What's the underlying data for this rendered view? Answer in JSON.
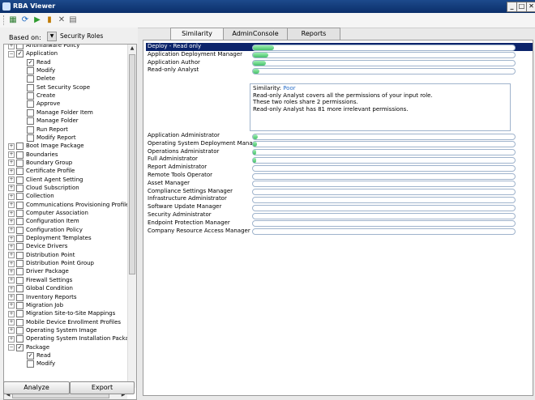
{
  "window": {
    "title": "RBA Viewer"
  },
  "toolbar": {
    "icons": [
      "grid-icon",
      "refresh-icon",
      "play-icon",
      "save-icon",
      "close-icon",
      "export-icon"
    ]
  },
  "left_panel": {
    "based_on_label": "Based on:",
    "based_on_value": "Security Roles",
    "tree": [
      {
        "label": "Antimalware Policy",
        "level": 0,
        "expander": "+",
        "checked": false
      },
      {
        "label": "Application",
        "level": 0,
        "expander": "−",
        "checked": true
      },
      {
        "label": "Read",
        "level": 1,
        "checked": true
      },
      {
        "label": "Modify",
        "level": 1,
        "checked": false
      },
      {
        "label": "Delete",
        "level": 1,
        "checked": false
      },
      {
        "label": "Set Security Scope",
        "level": 1,
        "checked": false
      },
      {
        "label": "Create",
        "level": 1,
        "checked": false
      },
      {
        "label": "Approve",
        "level": 1,
        "checked": false
      },
      {
        "label": "Manage Folder Item",
        "level": 1,
        "checked": false
      },
      {
        "label": "Manage Folder",
        "level": 1,
        "checked": false
      },
      {
        "label": "Run Report",
        "level": 1,
        "checked": false
      },
      {
        "label": "Modify Report",
        "level": 1,
        "checked": false
      },
      {
        "label": "Boot Image Package",
        "level": 0,
        "expander": "+",
        "checked": false
      },
      {
        "label": "Boundaries",
        "level": 0,
        "expander": "+",
        "checked": false
      },
      {
        "label": "Boundary Group",
        "level": 0,
        "expander": "+",
        "checked": false
      },
      {
        "label": "Certificate Profile",
        "level": 0,
        "expander": "+",
        "checked": false
      },
      {
        "label": "Client Agent Setting",
        "level": 0,
        "expander": "+",
        "checked": false
      },
      {
        "label": "Cloud Subscription",
        "level": 0,
        "expander": "+",
        "checked": false
      },
      {
        "label": "Collection",
        "level": 0,
        "expander": "+",
        "checked": false
      },
      {
        "label": "Communications Provisioning Profile",
        "level": 0,
        "expander": "+",
        "checked": false
      },
      {
        "label": "Computer Association",
        "level": 0,
        "expander": "+",
        "checked": false
      },
      {
        "label": "Configuration Item",
        "level": 0,
        "expander": "+",
        "checked": false
      },
      {
        "label": "Configuration Policy",
        "level": 0,
        "expander": "+",
        "checked": false
      },
      {
        "label": "Deployment Templates",
        "level": 0,
        "expander": "+",
        "checked": false
      },
      {
        "label": "Device Drivers",
        "level": 0,
        "expander": "+",
        "checked": false
      },
      {
        "label": "Distribution Point",
        "level": 0,
        "expander": "+",
        "checked": false
      },
      {
        "label": "Distribution Point Group",
        "level": 0,
        "expander": "+",
        "checked": false
      },
      {
        "label": "Driver Package",
        "level": 0,
        "expander": "+",
        "checked": false
      },
      {
        "label": "Firewall Settings",
        "level": 0,
        "expander": "+",
        "checked": false
      },
      {
        "label": "Global Condition",
        "level": 0,
        "expander": "+",
        "checked": false
      },
      {
        "label": "Inventory Reports",
        "level": 0,
        "expander": "+",
        "checked": false
      },
      {
        "label": "Migration Job",
        "level": 0,
        "expander": "+",
        "checked": false
      },
      {
        "label": "Migration Site-to-Site Mappings",
        "level": 0,
        "expander": "+",
        "checked": false
      },
      {
        "label": "Mobile Device Enrollment Profiles",
        "level": 0,
        "expander": "+",
        "checked": false
      },
      {
        "label": "Operating System Image",
        "level": 0,
        "expander": "+",
        "checked": false
      },
      {
        "label": "Operating System Installation Package",
        "level": 0,
        "expander": "+",
        "checked": false
      },
      {
        "label": "Package",
        "level": 0,
        "expander": "−",
        "checked": true
      },
      {
        "label": "Read",
        "level": 1,
        "checked": true
      },
      {
        "label": "Modify",
        "level": 1,
        "checked": false
      }
    ],
    "analyze_label": "Analyze",
    "export_label": "Export"
  },
  "tabs": [
    "Similarity",
    "AdminConsole",
    "Reports"
  ],
  "similarity": {
    "rows": [
      {
        "name": "Deploy - Read only",
        "fill": 0.08,
        "selected": true
      },
      {
        "name": "Application Deployment Manager",
        "fill": 0.06
      },
      {
        "name": "Application Author",
        "fill": 0.05
      },
      {
        "name": "Read-only Analyst",
        "fill": 0.025
      },
      {
        "name": "Application Administrator",
        "fill": 0.02
      },
      {
        "name": "Operating System Deployment Manager",
        "fill": 0.015
      },
      {
        "name": "Operations Administrator",
        "fill": 0.01
      },
      {
        "name": "Full Administrator",
        "fill": 0.008
      },
      {
        "name": "Report Administrator",
        "fill": 0
      },
      {
        "name": "Remote Tools Operator",
        "fill": 0
      },
      {
        "name": "Asset Manager",
        "fill": 0
      },
      {
        "name": "Compliance Settings Manager",
        "fill": 0
      },
      {
        "name": "Infrastructure Administrator",
        "fill": 0
      },
      {
        "name": "Software Update Manager",
        "fill": 0
      },
      {
        "name": "Security Administrator",
        "fill": 0
      },
      {
        "name": "Endpoint Protection Manager",
        "fill": 0
      },
      {
        "name": "Company Resource Access Manager",
        "fill": 0
      }
    ],
    "detail": {
      "similarity_label": "Similarity:",
      "similarity_value": "Poor",
      "line1": "Read-only Analyst covers all the permissions of your input role.",
      "line2": "These two roles share 2 permissions.",
      "line3": "Read-only Analyst has 81 more irrelevant permissions."
    }
  }
}
